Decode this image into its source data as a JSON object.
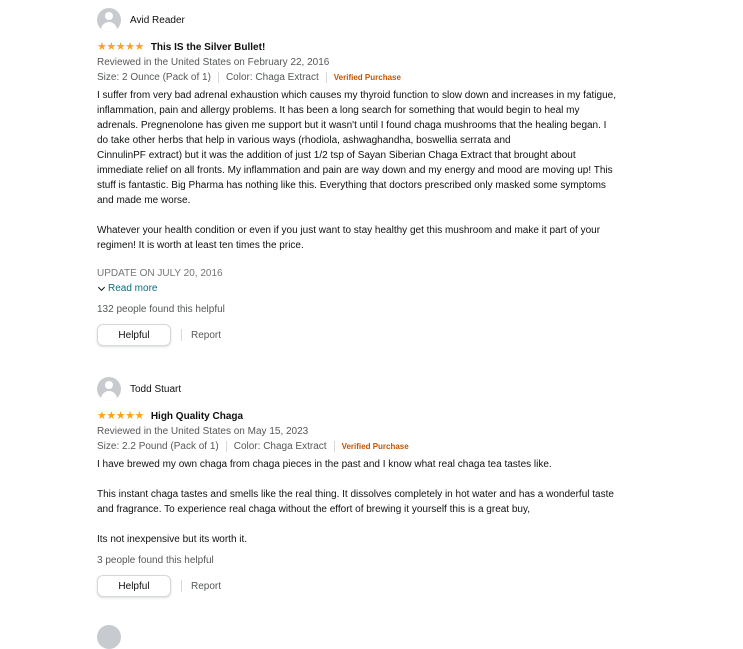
{
  "reviews": [
    {
      "reviewer": "Avid Reader",
      "stars": "★★★★★",
      "title": "This IS the Silver Bullet!",
      "date": "Reviewed in the United States on February 22, 2016",
      "size": "Size: 2 Ounce (Pack of 1)",
      "color": "Color: Chaga Extract",
      "verified": "Verified Purchase",
      "body": [
        "I suffer from very bad adrenal exhaustion which causes my thyroid function to slow down and increases in my fatigue, inflammation, pain and allergy problems. It has been a long search for something that would begin to heal my adrenals. Pregnenolone has given me support but it wasn't until I found chaga mushrooms that the healing began. I do take other herbs that help in various ways (rhodiola, ashwaghandha, boswellia serrata and\nCinnulinPF extract) but it was the addition of just 1/2 tsp of Sayan Siberian Chaga Extract that brought about immediate relief on all fronts. My inflammation and pain are way down and my energy and mood are moving up! This stuff is fantastic. Big Pharma has nothing like this. Everything that doctors prescribed only masked some symptoms and made me worse.",
        "Whatever your health condition or even if you just want to stay healthy get this mushroom and make it part of your regimen! It is worth at least ten times the price."
      ],
      "update": "UPDATE ON JULY 20, 2016",
      "read_more": "Read more",
      "helpful_count": "132 people found this helpful",
      "helpful_label": "Helpful",
      "report_label": "Report"
    },
    {
      "reviewer": "Todd Stuart",
      "stars": "★★★★★",
      "title": "High Quality Chaga",
      "date": "Reviewed in the United States on May 15, 2023",
      "size": "Size: 2.2 Pound (Pack of 1)",
      "color": "Color: Chaga Extract",
      "verified": "Verified Purchase",
      "body": [
        "I have brewed my own chaga from chaga pieces in the past and I know what real chaga tea tastes like.",
        "This instant chaga tastes and smells like the real thing. It dissolves completely in hot water and has a wonderful taste and fragrance. To experience real chaga without the effort of brewing it yourself this is a great buy,",
        "Its not inexpensive but its worth it."
      ],
      "helpful_count": "3 people found this helpful",
      "helpful_label": "Helpful",
      "report_label": "Report"
    }
  ]
}
